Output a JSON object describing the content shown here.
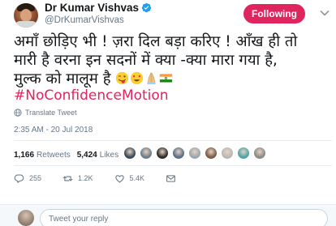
{
  "author": {
    "name": "Dr Kumar Vishvas",
    "handle": "@DrKumarVishvas",
    "verified": true
  },
  "follow_button": {
    "label": "Following",
    "color": "#e0245e"
  },
  "tweet": {
    "line1": "अमाँ छोड़िए भी ! ज़रा दिल बड़ा करिए ! आँख ही तो",
    "line2": "मारी है वरना इन सदनों में क्या -क्या मारा गया है,",
    "line3": "मुल्क को मालूम है",
    "emojis": [
      "winking-face-tongue-emoji",
      "heart-eyes-emoji",
      "folded-hands-emoji",
      "india-flag-emoji"
    ],
    "hashtag": "#NoConfidenceMotion",
    "translate_label": "Translate Tweet",
    "timestamp": "2:35 AM - 20 Jul 2018"
  },
  "stats": {
    "retweets_count": "1,166",
    "retweets_label": "Retweets",
    "likes_count": "5,424",
    "likes_label": "Likes",
    "liker_colors": [
      "#3a4a5a",
      "#6b7d8c",
      "#2c2c2c",
      "#5a6f88",
      "#9aa6b1",
      "#7a5c4a",
      "#b8b8b8",
      "#4ea3a8",
      "#8a8a8a"
    ]
  },
  "actions": {
    "replies": "255",
    "retweets": "1.2K",
    "likes": "5.4K"
  },
  "reply": {
    "placeholder": "Tweet your reply"
  },
  "colors": {
    "accent": "#e0245e",
    "muted": "#657786",
    "verified": "#1da1f2"
  }
}
